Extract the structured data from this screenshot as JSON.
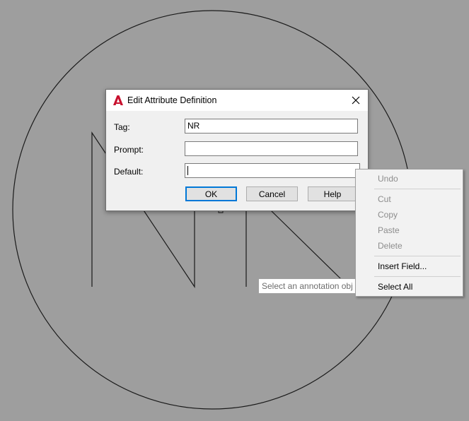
{
  "dialog": {
    "title": "Edit Attribute Definition",
    "fields": [
      {
        "label": "Tag:",
        "value": "NR"
      },
      {
        "label": "Prompt:",
        "value": ""
      },
      {
        "label": "Default:",
        "value": ""
      }
    ],
    "buttons": {
      "ok": "OK",
      "cancel": "Cancel",
      "help": "Help"
    }
  },
  "tooltip": {
    "text": "Select an annotation obj"
  },
  "context_menu": {
    "items": [
      {
        "label": "Undo",
        "enabled": false
      },
      {
        "label": "Cut",
        "enabled": false
      },
      {
        "label": "Copy",
        "enabled": false
      },
      {
        "label": "Paste",
        "enabled": false
      },
      {
        "label": "Delete",
        "enabled": false
      },
      {
        "label": "Insert Field...",
        "enabled": true
      },
      {
        "label": "Select All",
        "enabled": true
      }
    ]
  },
  "colors": {
    "canvas_background": "#9e9e9e",
    "drawing_lines": "#1a1a1a",
    "app_icon_red": "#c8102e",
    "default_button_border": "#0078d7"
  },
  "icons": [
    "autocad-logo-icon",
    "close-icon"
  ]
}
